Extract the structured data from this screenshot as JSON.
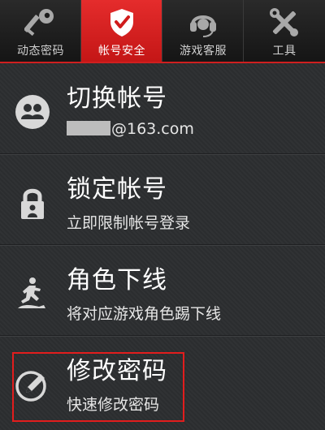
{
  "tabs": [
    {
      "label": "动态密码",
      "icon": "key-icon",
      "active": false
    },
    {
      "label": "帐号安全",
      "icon": "shield-check-icon",
      "active": true
    },
    {
      "label": "游戏客服",
      "icon": "headset-icon",
      "active": false
    },
    {
      "label": "工具",
      "icon": "tools-icon",
      "active": false
    }
  ],
  "items": [
    {
      "title": "切换帐号",
      "subtitle_suffix": "@163.com",
      "icon": "users-icon"
    },
    {
      "title": "锁定帐号",
      "subtitle": "立即限制帐号登录",
      "icon": "lock-icon"
    },
    {
      "title": "角色下线",
      "subtitle": "将对应游戏角色踢下线",
      "icon": "running-figure-icon"
    },
    {
      "title": "修改密码",
      "subtitle": "快速修改密码",
      "icon": "pencil-icon"
    }
  ],
  "colors": {
    "accent": "#d21f1f",
    "highlight": "#e21d1d",
    "background": "#2f3133"
  }
}
